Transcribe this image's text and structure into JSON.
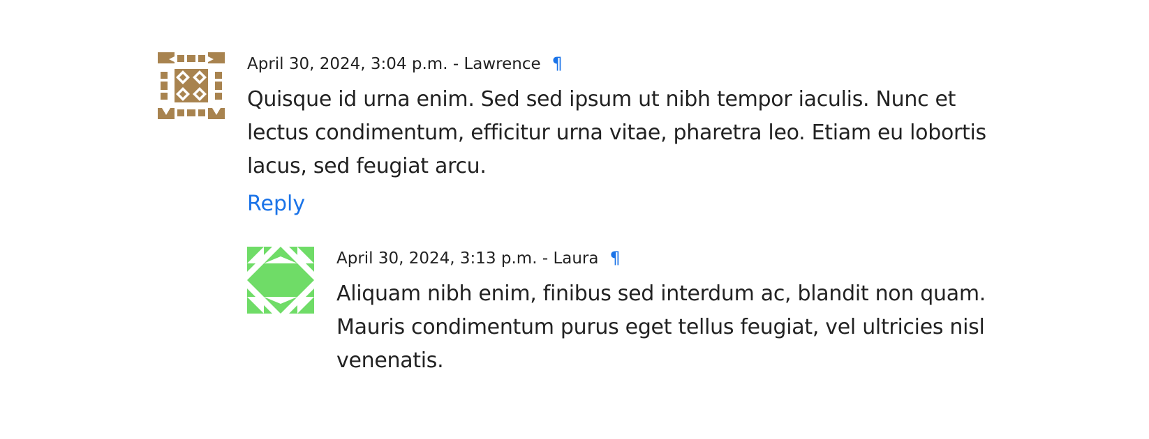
{
  "comments": [
    {
      "date": "April 30, 2024, 3:04 p.m.",
      "separator": " - ",
      "author": "Lawrence",
      "permalink": "¶",
      "text": "Quisque id urna enim. Sed sed ipsum ut nibh tempor iaculis. Nunc et lectus condimentum, efficitur urna vitae, pharetra leo. Etiam eu lobortis lacus, sed feugiat arcu.",
      "reply_label": "Reply",
      "avatar": {
        "icon": "identicon-avatar",
        "color": "#a8834f"
      }
    },
    {
      "date": "April 30, 2024, 3:13 p.m.",
      "separator": " - ",
      "author": "Laura",
      "permalink": "¶",
      "text": "Aliquam nibh enim, finibus sed interdum ac, blandit non quam. Mauris condimentum purus eget tellus feugiat, vel ultricies nisl venenatis.",
      "avatar": {
        "icon": "identicon-avatar",
        "color": "#6fdc67"
      }
    }
  ],
  "colors": {
    "link": "#1a73e8",
    "text": "#222222"
  }
}
